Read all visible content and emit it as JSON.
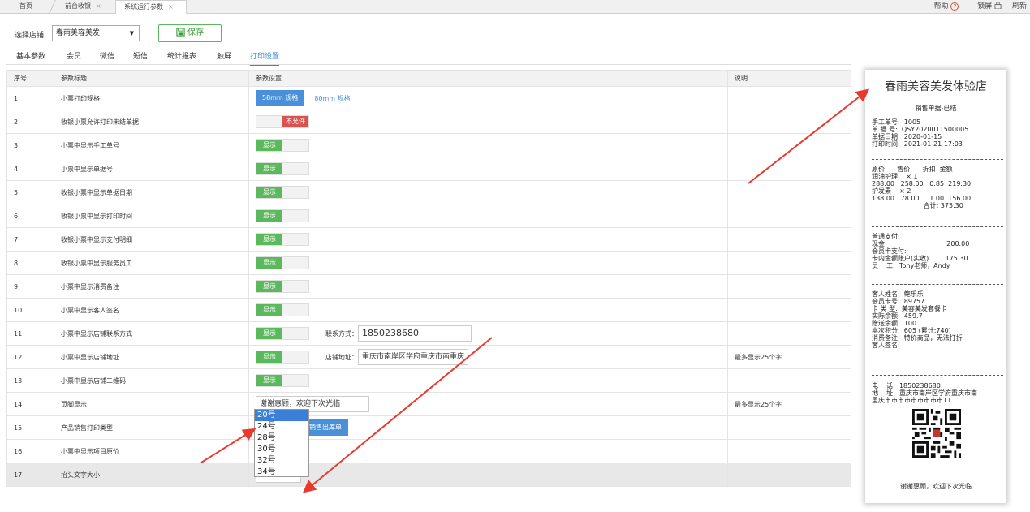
{
  "tabs": [
    {
      "label": "首页"
    },
    {
      "label": "前台收银",
      "close": "×"
    },
    {
      "label": "系统运行参数",
      "close": "×"
    }
  ],
  "topright": {
    "help": "帮助",
    "help_icon": "?",
    "lock": "锁屏",
    "refresh": "刷新"
  },
  "store": {
    "label": "选择店铺:",
    "value": "春雨美容美发",
    "arrow": "▼"
  },
  "save_label": "保存",
  "nav_tabs": [
    "基本参数",
    "会员",
    "微信",
    "短信",
    "统计报表",
    "触屏",
    "打印设置"
  ],
  "table": {
    "headers": [
      "序号",
      "参数标题",
      "参数设置",
      "说明"
    ],
    "rows": [
      {
        "no": "1",
        "title": "小票打印规格",
        "btn": "58mm 规格",
        "link": "80mm 规格"
      },
      {
        "no": "2",
        "title": "收银小票允许打印未结单据",
        "off": "不允许"
      },
      {
        "no": "3",
        "title": "小票中显示手工单号",
        "on": "显示"
      },
      {
        "no": "4",
        "title": "小票中显示单据号",
        "on": "显示"
      },
      {
        "no": "5",
        "title": "收银小票中显示单据日期",
        "on": "显示"
      },
      {
        "no": "6",
        "title": "收银小票中显示打印时间",
        "on": "显示"
      },
      {
        "no": "7",
        "title": "收银小票中显示支付明细",
        "on": "显示"
      },
      {
        "no": "8",
        "title": "收银小票中显示服务员工",
        "on": "显示"
      },
      {
        "no": "9",
        "title": "小票中显示消费备注",
        "on": "显示"
      },
      {
        "no": "10",
        "title": "小票中显示客人签名",
        "on": "显示"
      },
      {
        "no": "11",
        "title": "小票中显示店铺联系方式",
        "on": "显示",
        "field_label": "联系方式：",
        "field_value": "1850238680"
      },
      {
        "no": "12",
        "title": "小票中显示店铺地址",
        "on": "显示",
        "field_label": "店铺地址：",
        "field_value": "重庆市南岸区学府重庆市南重庆",
        "note": "最多显示25个字"
      },
      {
        "no": "13",
        "title": "小票中显示店铺二维码",
        "on": "显示"
      },
      {
        "no": "14",
        "title": "页脚显示",
        "input": "谢谢惠顾，欢迎下次光临",
        "note": "最多显示25个字"
      },
      {
        "no": "15",
        "title": "产品销售打印类型",
        "btn": "销售出库单"
      },
      {
        "no": "16",
        "title": "小票中显示项目原价",
        "on": "显示"
      },
      {
        "no": "17",
        "title": "抬头文字大小",
        "select": "20号",
        "arrow": "▼"
      }
    ]
  },
  "dropdown_options": [
    "20号",
    "24号",
    "28号",
    "30号",
    "32号",
    "34号"
  ],
  "receipt": {
    "title": "春雨美容美发体验店",
    "subtitle": "销售单据-已结",
    "block1": "手工单号:  1005\n单 据 号:  QSY2020011500005\n单据日期:  2020-01-15\n打印时间:  2021-01-21 17:03",
    "block2": "原价      售价      折扣  金额\n润油护理    × 1\n288.00   258.00   0.85  219.30\n护发素    × 2\n138.00   78.00     1.00  156.00\n                         合计: 375.30",
    "block3": "普通支付:\n现金                              200.00\n会员卡支付:\n卡内金额账户(实收)        175.30\n员    工:  Tony老师，Andy",
    "block4": "客人姓名:  鲍乐乐\n会员卡号:  89757\n卡 类 型:  美容美发套餐卡\n实际余额:  459.7\n赠送余额:  100\n本次积分:  605 (累计:740)\n消费备注:  特价商品，无法打折\n客人签名:",
    "block5": "电    话:  1850238680\n地    址:  重庆市南岸区学府重庆市南\n重庆市市市市市市市市市11",
    "footer": "谢谢惠顾，欢迎下次光临"
  },
  "colors": {
    "accent": "#3a86d8",
    "on": "#5cb85c",
    "off": "#d9534f",
    "arrow": "#e8392d"
  }
}
